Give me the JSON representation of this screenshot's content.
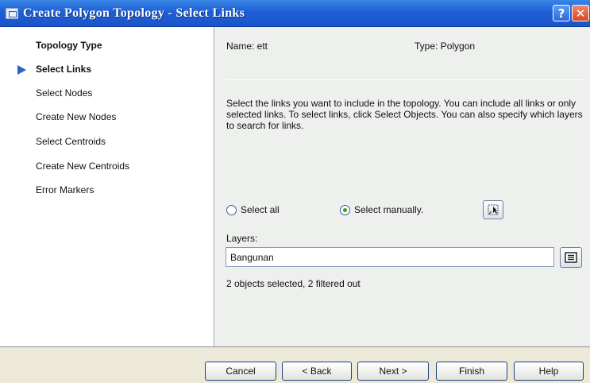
{
  "window": {
    "title": "Create Polygon Topology - Select Links",
    "help_glyph": "?",
    "close_glyph": "✕"
  },
  "sidebar": {
    "steps": [
      {
        "label": "Topology Type",
        "bold": true
      },
      {
        "label": "Select Links",
        "bold": true,
        "current": true
      },
      {
        "label": "Select Nodes"
      },
      {
        "label": "Create New Nodes"
      },
      {
        "label": "Select Centroids"
      },
      {
        "label": "Create New Centroids"
      },
      {
        "label": "Error Markers"
      }
    ]
  },
  "main": {
    "name_label": "Name: ett",
    "type_label": "Type: Polygon",
    "description": "Select the links you want to include in the topology. You can include all links or only selected links. To select links, click Select Objects. You can also specify which layers to search for links.",
    "radio_select_all": "Select all",
    "radio_select_manually": "Select manually.",
    "selected_radio": "select_manually",
    "layers_label": "Layers:",
    "layers_value": "Bangunan",
    "status_text": "2 objects selected, 2 filtered out",
    "select_objects_icon": "select-objects-icon",
    "layers_picker_icon": "layer-list-icon"
  },
  "footer": {
    "cancel": "Cancel",
    "back": "< Back",
    "next": "Next >",
    "finish": "Finish",
    "help": "Help"
  },
  "colors": {
    "titlebar": "#1e5fd6",
    "panel": "#eef0ee",
    "footer": "#ece9d8",
    "current_step_arrow": "#2a62c8"
  }
}
